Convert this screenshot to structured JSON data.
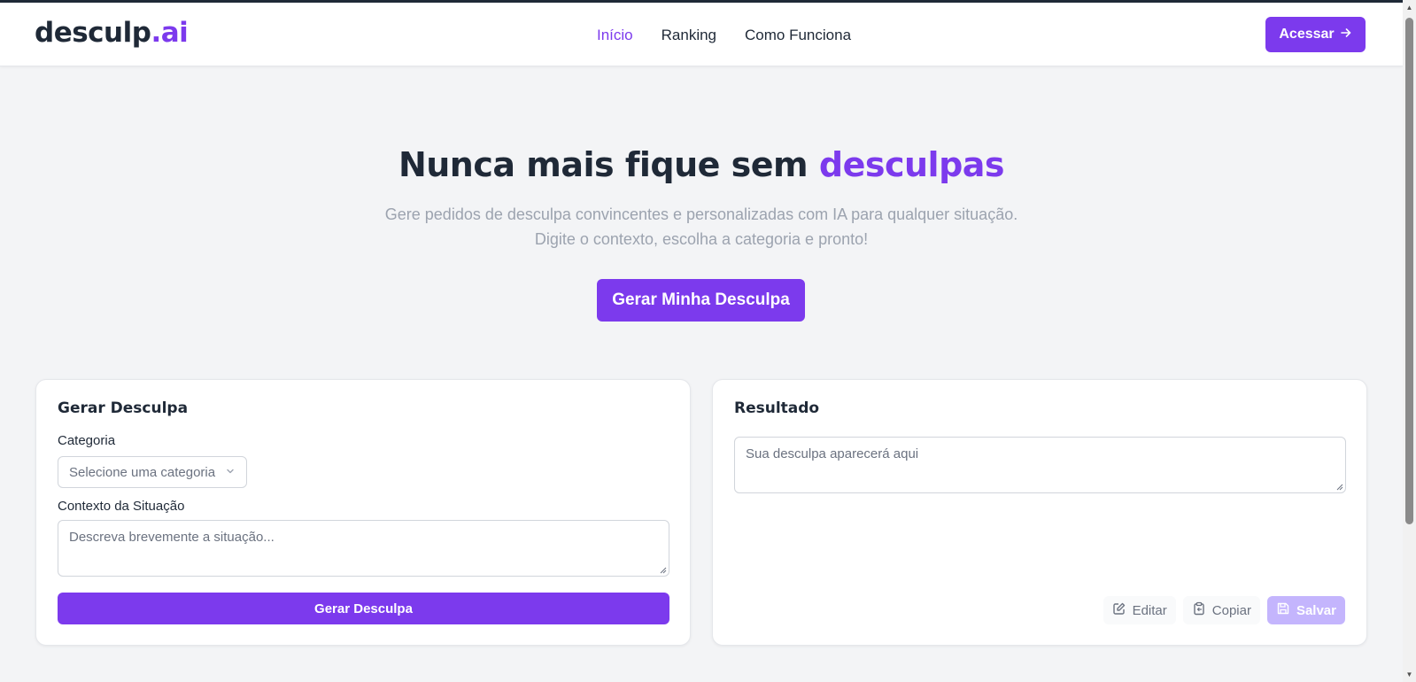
{
  "header": {
    "logo_main": "desculp",
    "logo_accent": ".ai",
    "nav": [
      {
        "label": "Início",
        "active": true
      },
      {
        "label": "Ranking",
        "active": false
      },
      {
        "label": "Como Funciona",
        "active": false
      }
    ],
    "cta_label": "Acessar"
  },
  "hero": {
    "title_main": "Nunca mais fique sem",
    "title_accent": "desculpas",
    "subtitle_line1": "Gere pedidos de desculpa convincentes e personalizadas com IA para qualquer situação.",
    "subtitle_line2": "Digite o contexto, escolha a categoria e pronto!",
    "cta_label": "Gerar Minha Desculpa"
  },
  "generator": {
    "title": "Gerar Desculpa",
    "category_label": "Categoria",
    "category_placeholder": "Selecione uma categoria",
    "context_label": "Contexto da Situação",
    "context_placeholder": "Descreva brevemente a situação...",
    "submit_label": "Gerar Desculpa"
  },
  "result": {
    "title": "Resultado",
    "placeholder": "Sua desculpa aparecerá aqui",
    "actions": {
      "edit": "Editar",
      "copy": "Copiar",
      "save": "Salvar"
    }
  },
  "colors": {
    "accent": "#7c3aed",
    "accent_disabled": "#c4b5fd",
    "background": "#f3f4f6",
    "text": "#1f2937",
    "muted": "#9ca3af"
  },
  "icons": {
    "cta_arrow": "arrow-right-icon",
    "select_chevron": "chevron-down-icon",
    "edit": "pencil-square-icon",
    "copy": "clipboard-icon",
    "save": "floppy-disk-icon"
  }
}
